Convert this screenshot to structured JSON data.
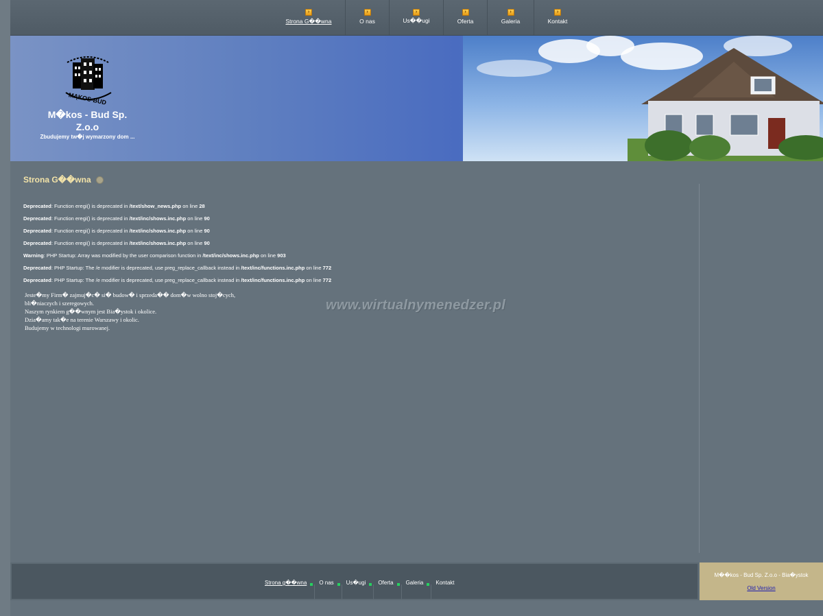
{
  "nav": {
    "items": [
      {
        "label": "Strona G��wna",
        "active": true
      },
      {
        "label": "O nas",
        "active": false
      },
      {
        "label": "Us��ugi",
        "active": false
      },
      {
        "label": "Oferta",
        "active": false
      },
      {
        "label": "Galeria",
        "active": false
      },
      {
        "label": "Kontakt",
        "active": false
      }
    ]
  },
  "header": {
    "logo_text": "MĄKOS-BUD",
    "brand_line1": "M�kos - Bud Sp.",
    "brand_line2": "Z.o.o",
    "tagline": "Zbudujemy tw�j wymarzony dom ..."
  },
  "main": {
    "title": "Strona G��wna",
    "messages": [
      {
        "level": "Deprecated",
        "text": ": Function eregi() is deprecated in ",
        "file": "/text/show_news.php",
        "mid": " on line ",
        "line": "28"
      },
      {
        "level": "Deprecated",
        "text": ": Function eregi() is deprecated in ",
        "file": "/text/inc/shows.inc.php",
        "mid": " on line ",
        "line": "90"
      },
      {
        "level": "Deprecated",
        "text": ": Function eregi() is deprecated in ",
        "file": "/text/inc/shows.inc.php",
        "mid": " on line ",
        "line": "90"
      },
      {
        "level": "Deprecated",
        "text": ": Function eregi() is deprecated in ",
        "file": "/text/inc/shows.inc.php",
        "mid": " on line ",
        "line": "90"
      },
      {
        "level": "Warning",
        "text": ": PHP Startup: Array was modified by the user comparison function in ",
        "file": "/text/inc/shows.inc.php",
        "mid": " on line ",
        "line": "903"
      },
      {
        "level": "Deprecated",
        "text": ": PHP Startup: The /e modifier is deprecated, use preg_replace_callback instead in ",
        "file": "/text/inc/functions.inc.php",
        "mid": " on line ",
        "line": "772"
      },
      {
        "level": "Deprecated",
        "text": ": PHP Startup: The /e modifier is deprecated, use preg_replace_callback instead in ",
        "file": "/text/inc/functions.inc.php",
        "mid": " on line ",
        "line": "772"
      }
    ],
    "body_lines": [
      "Jeste�my Firm� zajmuj�c� si� budow� i sprzeda�� dom�w wolno stoj�cych,",
      "bli�niaczych i szeregowych.",
      "Naszym rynkiem g��wnym jest Bia�ystok i okolice.",
      "Dzia�amy tak�e na terenie Warszawy i okolic.",
      "Budujemy w technologi murowanej."
    ],
    "watermark": "www.wirtualnymenedzer.pl"
  },
  "footer": {
    "nav": [
      {
        "label": "Strona g��wna",
        "active": true
      },
      {
        "label": "O nas",
        "active": false
      },
      {
        "label": "Us�ugi",
        "active": false
      },
      {
        "label": "Oferta",
        "active": false
      },
      {
        "label": "Galeria",
        "active": false
      },
      {
        "label": "Kontakt",
        "active": false
      }
    ],
    "info": "M��kos - Bud Sp. Z.o.o - Bia�ystok",
    "old_version": "Old Version"
  },
  "colors": {
    "background": "#65727c",
    "title": "#f3e3a8",
    "footer_box": "#c4b68a",
    "footer_marker": "#27d060"
  }
}
